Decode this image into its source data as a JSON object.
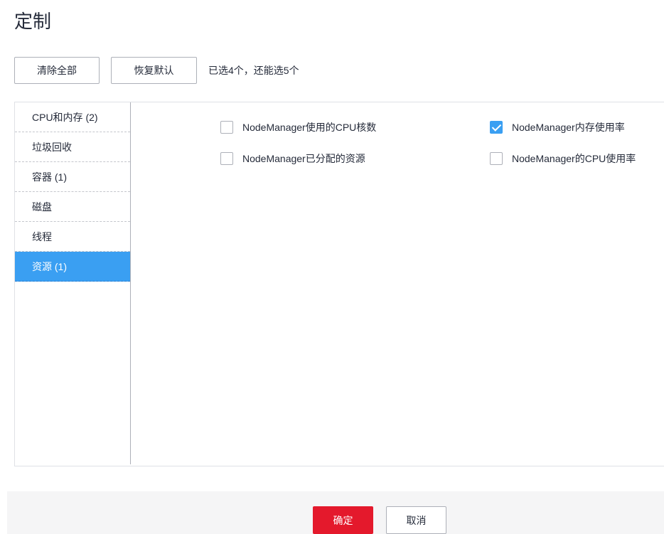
{
  "dialog": {
    "title": "定制"
  },
  "toolbar": {
    "clear_label": "清除全部",
    "restore_label": "恢复默认",
    "selection_hint": "已选4个，还能选5个"
  },
  "sidebar": {
    "items": [
      {
        "label": "CPU和内存 (2)",
        "active": false
      },
      {
        "label": "垃圾回收",
        "active": false
      },
      {
        "label": "容器 (1)",
        "active": false
      },
      {
        "label": "磁盘",
        "active": false
      },
      {
        "label": "线程",
        "active": false
      },
      {
        "label": "资源 (1)",
        "active": true
      }
    ]
  },
  "options": [
    {
      "label": "NodeManager使用的CPU核数",
      "checked": false
    },
    {
      "label": "NodeManager内存使用率",
      "checked": true
    },
    {
      "label": "NodeManager已分配的资源",
      "checked": false
    },
    {
      "label": "NodeManager的CPU使用率",
      "checked": false
    }
  ],
  "footer": {
    "ok_label": "确定",
    "cancel_label": "取消"
  },
  "colors": {
    "accent": "#3a9ff2",
    "primary_button": "#e4192c"
  }
}
